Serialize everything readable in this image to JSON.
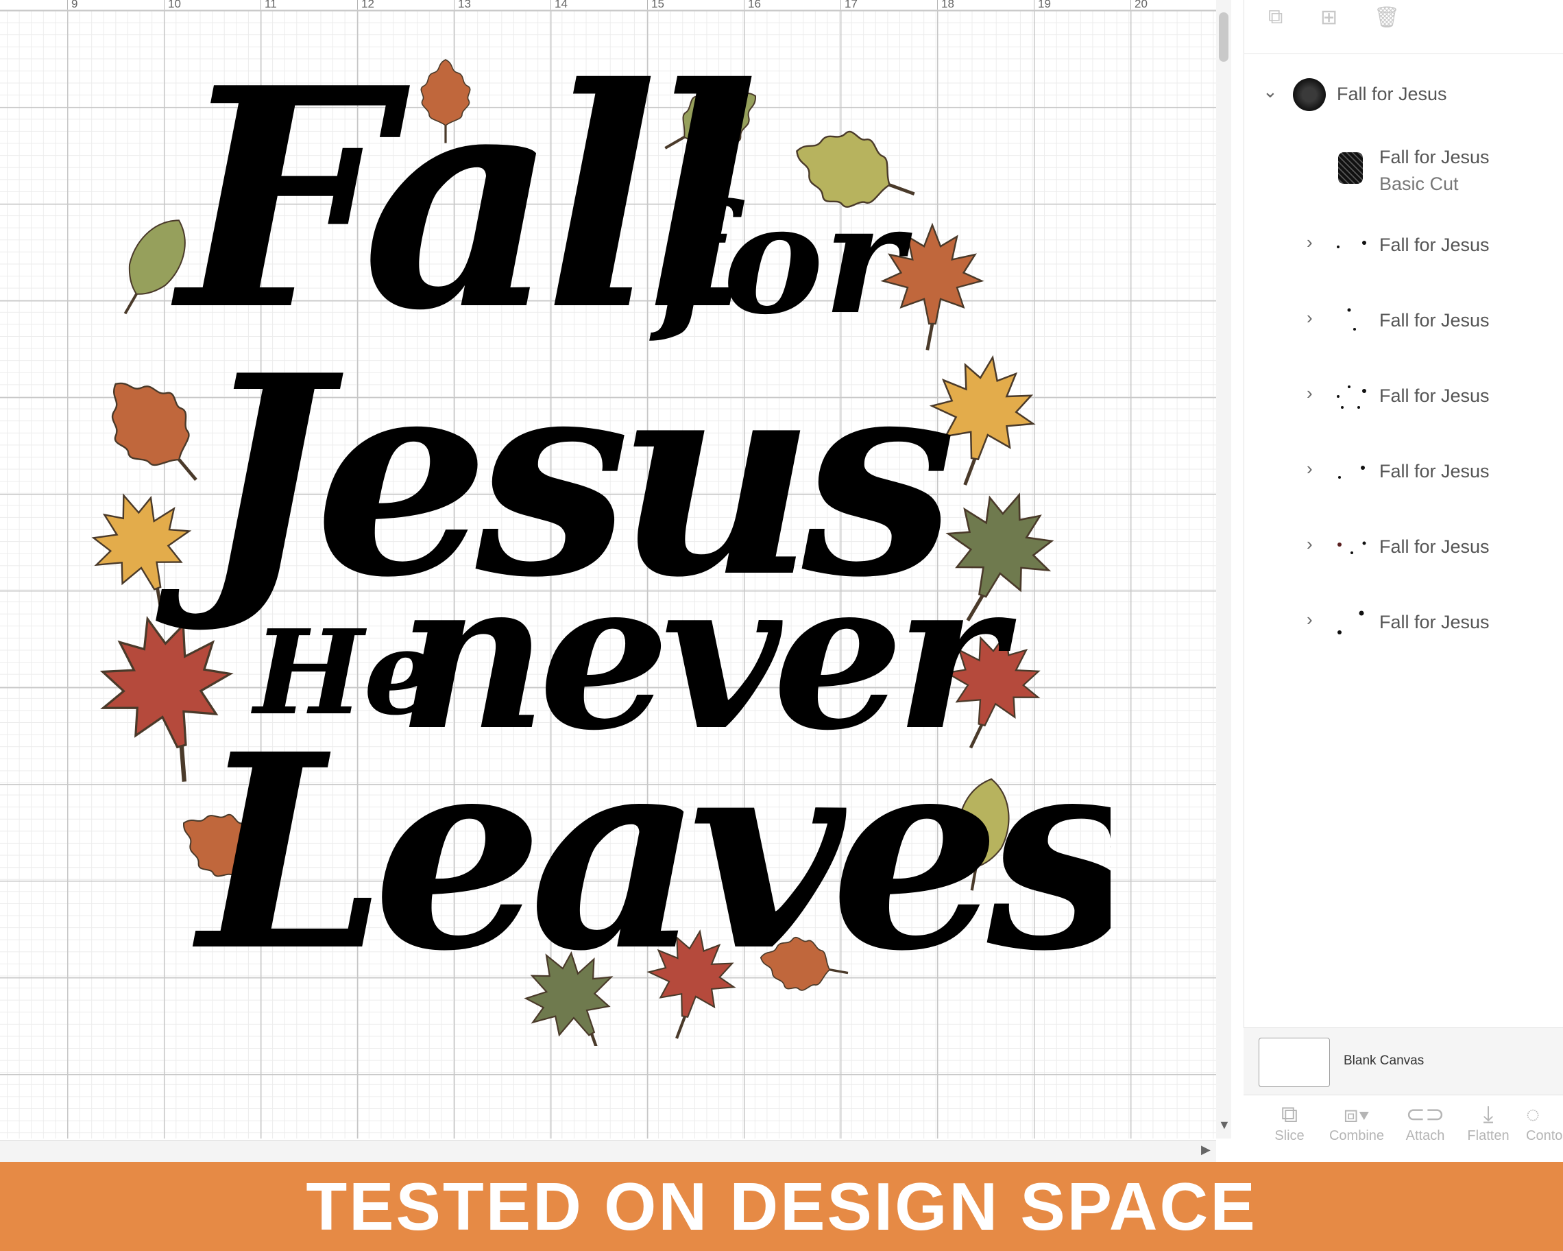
{
  "ruler": {
    "marks": [
      "9",
      "10",
      "11",
      "12",
      "13",
      "14",
      "15",
      "16",
      "17",
      "18",
      "19",
      "20"
    ]
  },
  "design": {
    "line1": "Fall",
    "line1b": "for",
    "line2": "Jesus",
    "line3a": "He",
    "line3b": "never",
    "line4": "Leaves"
  },
  "layers": {
    "group_label": "Fall for Jesus",
    "item_label": "Fall for Jesus",
    "item_sublabel": "Basic Cut",
    "children": [
      "Fall for Jesus",
      "Fall for Jesus",
      "Fall for Jesus",
      "Fall for Jesus",
      "Fall for Jesus",
      "Fall for Jesus"
    ]
  },
  "canvas_row": {
    "label": "Blank Canvas"
  },
  "bottom_tools": [
    "Slice",
    "Combine",
    "Attach",
    "Flatten",
    "Conto"
  ],
  "banner": {
    "text": "TESTED ON DESIGN SPACE"
  },
  "colors": {
    "banner": "#e68a45",
    "leaf_orange": "#c0673c",
    "leaf_olive": "#96a05c",
    "leaf_yellow": "#e3ac4b",
    "leaf_red": "#b54a3c",
    "leaf_green": "#6f7a4e",
    "leaf_khaki": "#b7b35e"
  }
}
